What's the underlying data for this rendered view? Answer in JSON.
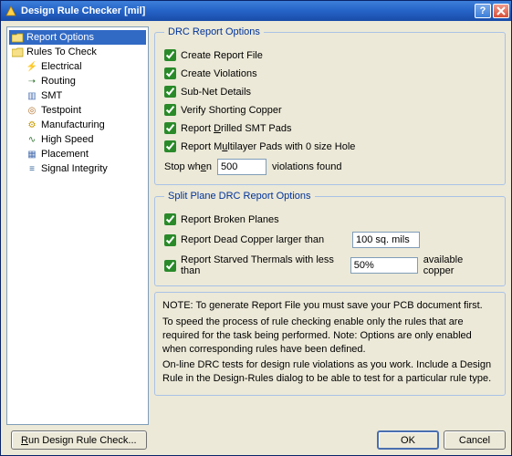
{
  "window": {
    "title": "Design Rule Checker [mil]"
  },
  "tree": {
    "root1": "Report Options",
    "root2": "Rules To Check",
    "items": [
      "Electrical",
      "Routing",
      "SMT",
      "Testpoint",
      "Manufacturing",
      "High Speed",
      "Placement",
      "Signal Integrity"
    ]
  },
  "drc": {
    "legend": "DRC Report Options",
    "create_report": "Create Report File",
    "create_violations": "Create Violations",
    "subnet_details": "Sub-Net Details",
    "verify_shorting": "Verify Shorting Copper",
    "drilled_smt": "Report Drilled SMT Pads",
    "multilayer": "Report Multilayer Pads with 0 size Hole",
    "stop_when_prefix": "Stop wh",
    "stop_when_u": "e",
    "stop_when_suffix": "n",
    "stop_when_value": "500",
    "stop_when_after": "violations found"
  },
  "split": {
    "legend": "Split Plane DRC Report Options",
    "broken": "Report Broken Planes",
    "dead_copper": "Report Dead Copper larger than",
    "dead_value": "100 sq. mils",
    "starved": "Report Starved Thermals with less than",
    "starved_value": "50%",
    "starved_after": "available copper"
  },
  "note": {
    "l1": "NOTE: To generate Report File you must save your PCB document first.",
    "l2": "To speed the process of rule checking enable only the rules that are required for the task being performed.  Note: Options are only enabled when corresponding rules have been defined.",
    "l3": "On-line DRC tests for design rule violations as you work. Include a Design Rule in the Design-Rules dialog to be able to test for a particular rule  type."
  },
  "buttons": {
    "run": "Run Design Rule Check...",
    "ok": "OK",
    "cancel": "Cancel"
  }
}
